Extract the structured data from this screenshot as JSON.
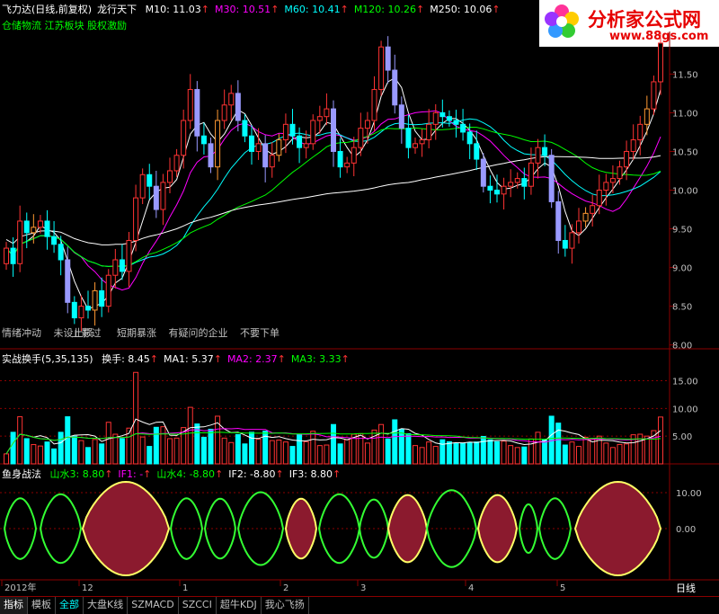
{
  "header": {
    "title": "飞力达(日线,前复权)",
    "indicator_name": "龙行天下",
    "ma_items": [
      {
        "label": "M10: 11.03",
        "color": "#ffffff"
      },
      {
        "label": "M30: 10.51",
        "color": "#ff00ff"
      },
      {
        "label": "M60: 10.41",
        "color": "#00ffff"
      },
      {
        "label": "M120: 10.26",
        "color": "#00ff00"
      },
      {
        "label": "M250: 10.06",
        "color": "#ffffff"
      }
    ],
    "tags": "仓储物流 江苏板块 股权激励"
  },
  "logo": {
    "main": "分析家公式网",
    "sub": "www.88gs.com"
  },
  "notes": {
    "items": [
      "情绪冲动",
      "未设止损",
      "上影过",
      "短期暴涨",
      "有疑问的企业",
      "不要下单"
    ]
  },
  "volume_panel": {
    "header": "实战换手(5,35,135)",
    "items": [
      {
        "label": "换手: 8.45",
        "color": "#ffffff"
      },
      {
        "label": "MA1: 5.37",
        "color": "#ffffff"
      },
      {
        "label": "MA2: 2.37",
        "color": "#ff00ff"
      },
      {
        "label": "MA3: 3.33",
        "color": "#00ff00"
      }
    ]
  },
  "fish_panel": {
    "header": "鱼身战法",
    "items": [
      {
        "label": "山水3: 8.80",
        "color": "#00ff00"
      },
      {
        "label": "IF1: -",
        "color": "#ff00ff"
      },
      {
        "label": "山水4: -8.80",
        "color": "#00ff00"
      },
      {
        "label": "IF2: -8.80",
        "color": "#ffffff"
      },
      {
        "label": "IF3: 8.80",
        "color": "#ffffff"
      }
    ]
  },
  "tabs": [
    "指标",
    "模板",
    "全部",
    "大盘K线",
    "SZMACD",
    "SZCCI",
    "超牛KDJ",
    "我心飞扬"
  ],
  "period_label": "日线",
  "chart_data": [
    {
      "type": "candlestick",
      "y_ticks": [
        "8.00",
        "8.50",
        "9.00",
        "9.50",
        "10.00",
        "10.50",
        "11.00",
        "11.50"
      ],
      "ylim": [
        7.95,
        12.05
      ],
      "x_labels": [
        "2012年",
        "12",
        "1",
        "2",
        "3",
        "4",
        "5"
      ],
      "ma_latest": {
        "M10": 11.03,
        "M30": 10.51,
        "M60": 10.41,
        "M120": 10.26,
        "M250": 10.06
      },
      "close_approx": [
        9.25,
        9.05,
        9.6,
        9.45,
        9.52,
        9.6,
        9.4,
        9.3,
        9.1,
        8.55,
        8.35,
        8.5,
        8.45,
        8.7,
        8.5,
        8.9,
        9.1,
        8.95,
        9.35,
        9.9,
        10.2,
        10.05,
        9.75,
        10.1,
        10.25,
        10.45,
        10.9,
        11.3,
        10.7,
        10.6,
        10.3,
        10.9,
        11.1,
        11.25,
        10.9,
        10.7,
        10.5,
        10.6,
        10.3,
        10.45,
        10.65,
        10.85,
        10.7,
        10.55,
        10.6,
        10.9,
        10.95,
        11.05,
        10.5,
        10.3,
        10.35,
        10.55,
        10.8,
        10.9,
        11.3,
        11.85,
        11.55,
        11.1,
        10.8,
        10.55,
        10.6,
        10.65,
        10.85,
        11.0,
        10.95,
        10.9,
        10.85,
        10.75,
        10.6,
        10.4,
        10.05,
        10.0,
        9.95,
        10.05,
        10.1,
        10.15,
        10.05,
        10.35,
        10.55,
        10.45,
        9.85,
        9.35,
        9.25,
        9.45,
        9.6,
        9.7,
        9.8,
        10.0,
        10.1,
        10.15,
        10.3,
        10.5,
        10.65,
        10.85,
        11.05,
        11.4,
        11.9
      ]
    },
    {
      "type": "bar",
      "y_ticks": [
        "5.00",
        "10.00",
        "15.00"
      ],
      "ylim": [
        0,
        18
      ],
      "latest": {
        "turnover": 8.45,
        "MA1": 5.37,
        "MA2": 2.37,
        "MA3": 3.33
      }
    },
    {
      "type": "area",
      "y_ticks": [
        "0.00",
        "10.00"
      ],
      "latest": {
        "山水3": 8.8,
        "山水4": -8.8,
        "IF2": -8.8,
        "IF3": 8.8
      }
    }
  ]
}
